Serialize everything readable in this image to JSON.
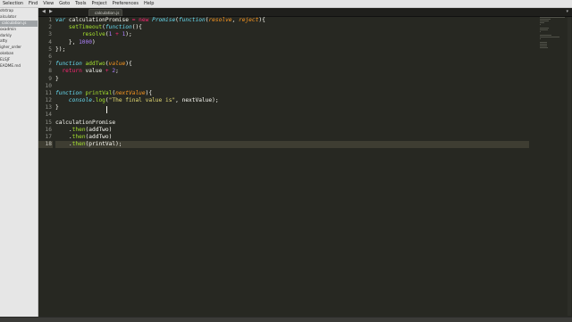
{
  "menu": [
    "Selection",
    "Find",
    "View",
    "Goto",
    "Tools",
    "Project",
    "Preferences",
    "Help"
  ],
  "sidebar": {
    "items": [
      {
        "label": "otstrap",
        "selected": false
      },
      {
        "label": "alculator",
        "selected": false
      },
      {
        "label": "calculation.js",
        "selected": true
      },
      {
        "label": "oxadmin",
        "selected": false
      },
      {
        "label": "darkly",
        "selected": false
      },
      {
        "label": "atty",
        "selected": false
      },
      {
        "label": "igher_order",
        "selected": false
      },
      {
        "label": "okeban",
        "selected": false
      },
      {
        "label": "ELSJF",
        "selected": false
      },
      {
        "label": "EADME.md",
        "selected": false
      }
    ]
  },
  "tabbar": {
    "nav_left": "◀",
    "nav_right": "▶",
    "tab_label": "calculation.js",
    "dropdown": "▾"
  },
  "editor": {
    "current_line": 18,
    "lines": [
      {
        "n": "1",
        "tokens": [
          {
            "t": "var",
            "c": "kw"
          },
          {
            "t": " calculationPromise ",
            "c": ""
          },
          {
            "t": "=",
            "c": "kw2"
          },
          {
            "t": " ",
            "c": ""
          },
          {
            "t": "new",
            "c": "kw2"
          },
          {
            "t": " ",
            "c": ""
          },
          {
            "t": "Promise",
            "c": "kw"
          },
          {
            "t": "(",
            "c": ""
          },
          {
            "t": "function",
            "c": "kw"
          },
          {
            "t": "(",
            "c": ""
          },
          {
            "t": "resolve",
            "c": "par"
          },
          {
            "t": ", ",
            "c": ""
          },
          {
            "t": "reject",
            "c": "par"
          },
          {
            "t": "){",
            "c": ""
          }
        ]
      },
      {
        "n": "2",
        "tokens": [
          {
            "t": "    ",
            "c": ""
          },
          {
            "t": "setTimeout",
            "c": "fn"
          },
          {
            "t": "(",
            "c": ""
          },
          {
            "t": "function",
            "c": "kw"
          },
          {
            "t": "(){",
            "c": ""
          }
        ]
      },
      {
        "n": "3",
        "tokens": [
          {
            "t": "        ",
            "c": ""
          },
          {
            "t": "resolve",
            "c": "fn"
          },
          {
            "t": "(",
            "c": ""
          },
          {
            "t": "1",
            "c": "num"
          },
          {
            "t": " ",
            "c": ""
          },
          {
            "t": "+",
            "c": "kw2"
          },
          {
            "t": " ",
            "c": ""
          },
          {
            "t": "1",
            "c": "num"
          },
          {
            "t": ");",
            "c": ""
          }
        ]
      },
      {
        "n": "4",
        "tokens": [
          {
            "t": "    }, ",
            "c": ""
          },
          {
            "t": "1000",
            "c": "num"
          },
          {
            "t": ")",
            "c": ""
          }
        ]
      },
      {
        "n": "5",
        "tokens": [
          {
            "t": "});",
            "c": ""
          }
        ]
      },
      {
        "n": "6",
        "tokens": []
      },
      {
        "n": "7",
        "tokens": [
          {
            "t": "function",
            "c": "kw"
          },
          {
            "t": " ",
            "c": ""
          },
          {
            "t": "addTwo",
            "c": "fn"
          },
          {
            "t": "(",
            "c": ""
          },
          {
            "t": "value",
            "c": "par"
          },
          {
            "t": "){",
            "c": ""
          }
        ]
      },
      {
        "n": "8",
        "tokens": [
          {
            "t": "  ",
            "c": ""
          },
          {
            "t": "return",
            "c": "kw2"
          },
          {
            "t": " value ",
            "c": ""
          },
          {
            "t": "+",
            "c": "kw2"
          },
          {
            "t": " ",
            "c": ""
          },
          {
            "t": "2",
            "c": "num"
          },
          {
            "t": ";",
            "c": ""
          }
        ]
      },
      {
        "n": "9",
        "tokens": [
          {
            "t": "}",
            "c": ""
          }
        ]
      },
      {
        "n": "10",
        "tokens": []
      },
      {
        "n": "11",
        "tokens": [
          {
            "t": "function",
            "c": "kw"
          },
          {
            "t": " ",
            "c": ""
          },
          {
            "t": "printVal",
            "c": "fn"
          },
          {
            "t": "(",
            "c": ""
          },
          {
            "t": "nextValue",
            "c": "par"
          },
          {
            "t": "){",
            "c": ""
          }
        ]
      },
      {
        "n": "12",
        "tokens": [
          {
            "t": "    ",
            "c": ""
          },
          {
            "t": "console",
            "c": "kw"
          },
          {
            "t": ".",
            "c": ""
          },
          {
            "t": "log",
            "c": "fn"
          },
          {
            "t": "(",
            "c": ""
          },
          {
            "t": "\"The final value is\"",
            "c": "str"
          },
          {
            "t": ", nextValue);",
            "c": ""
          }
        ]
      },
      {
        "n": "13",
        "tokens": [
          {
            "t": "}",
            "c": ""
          }
        ]
      },
      {
        "n": "14",
        "tokens": []
      },
      {
        "n": "15",
        "tokens": [
          {
            "t": "calculationPromise",
            "c": ""
          }
        ]
      },
      {
        "n": "16",
        "tokens": [
          {
            "t": "    .",
            "c": ""
          },
          {
            "t": "then",
            "c": "fn"
          },
          {
            "t": "(addTwo)",
            "c": ""
          }
        ]
      },
      {
        "n": "17",
        "tokens": [
          {
            "t": "    .",
            "c": ""
          },
          {
            "t": "then",
            "c": "fn"
          },
          {
            "t": "(addTwo)",
            "c": ""
          }
        ]
      },
      {
        "n": "18",
        "tokens": [
          {
            "t": "    .",
            "c": ""
          },
          {
            "t": "then",
            "c": "fn"
          },
          {
            "t": "(printVal);",
            "c": ""
          }
        ]
      }
    ]
  },
  "colors": {
    "background": "#272822",
    "keyword": "#66d9ef",
    "operator": "#f92672",
    "function": "#a6e22e",
    "parameter": "#fd971f",
    "number": "#ae81ff",
    "string": "#e6db74",
    "text": "#f8f8f2"
  }
}
